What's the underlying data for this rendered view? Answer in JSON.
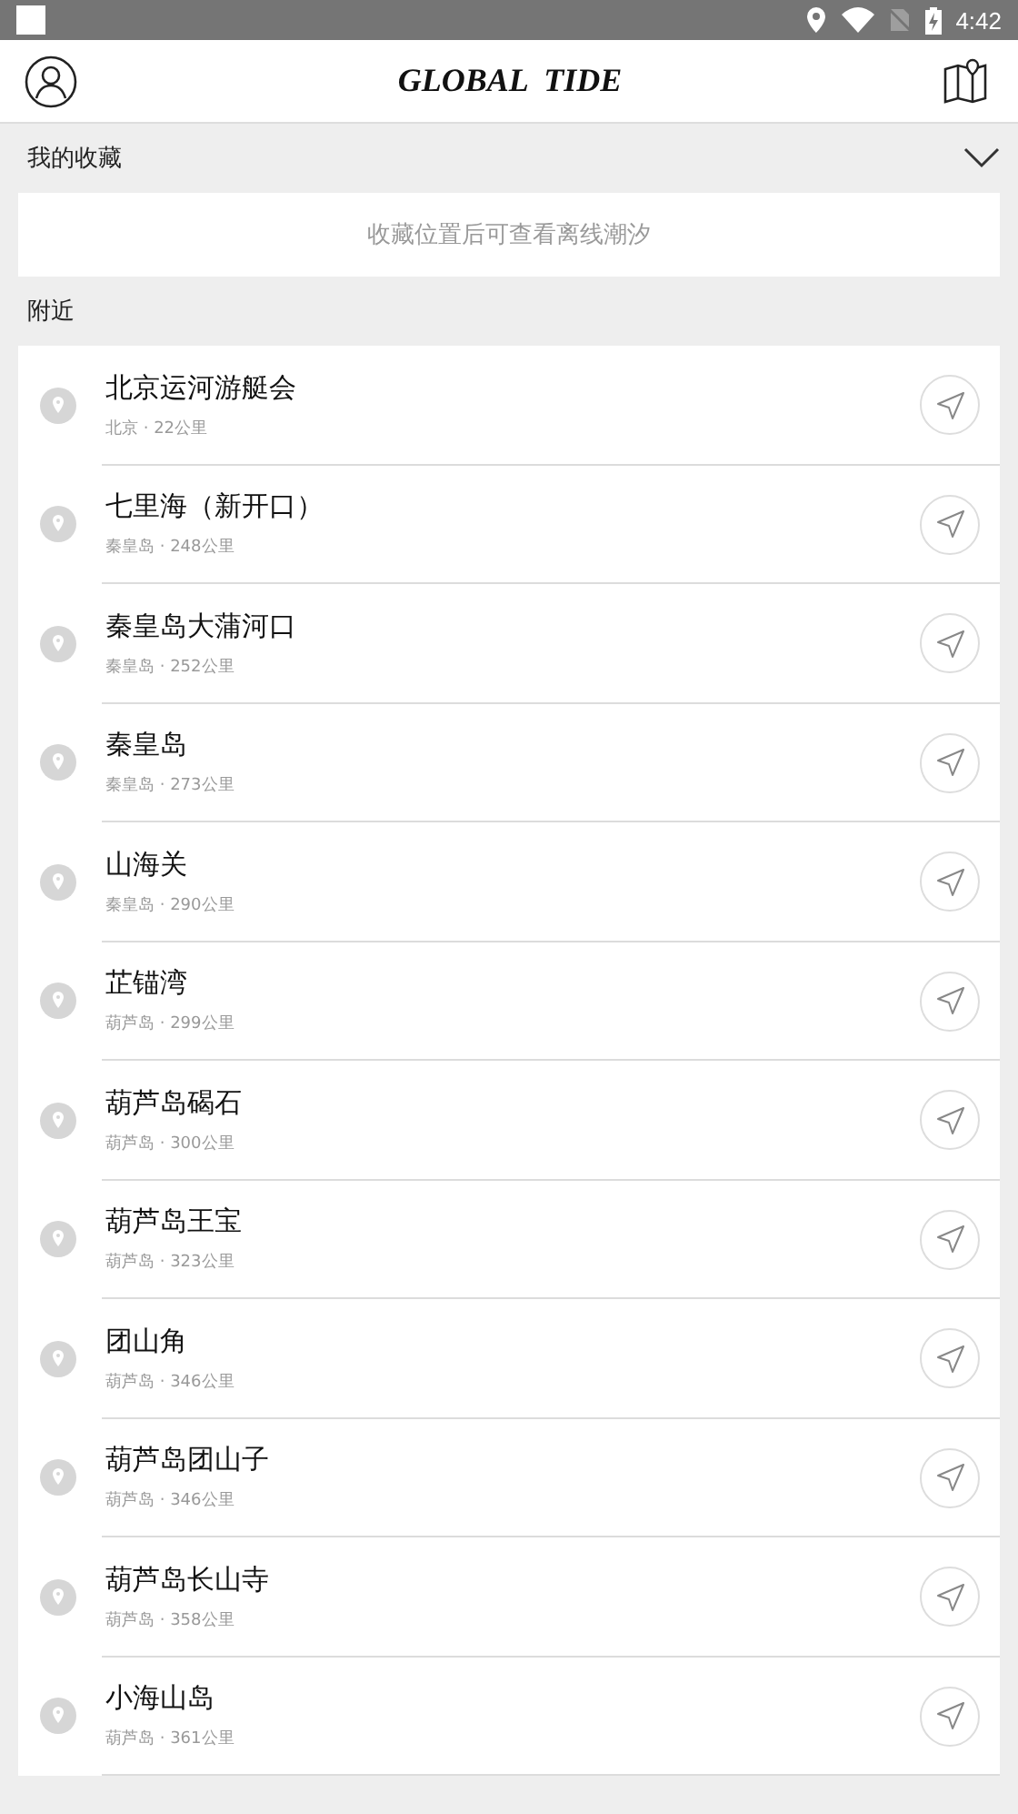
{
  "status_bar": {
    "time": "4:42"
  },
  "header": {
    "title": "GLOBAL  TIDE"
  },
  "favorites": {
    "label": "我的收藏",
    "expanded": true,
    "empty_text": "收藏位置后可查看离线潮汐"
  },
  "nearby": {
    "label": "附近",
    "items": [
      {
        "name": "北京运河游艇会",
        "detail": "北京 · 22公里"
      },
      {
        "name": "七里海（新开口）",
        "detail": "秦皇岛 · 248公里"
      },
      {
        "name": "秦皇岛大蒲河口",
        "detail": "秦皇岛 · 252公里"
      },
      {
        "name": "秦皇岛",
        "detail": "秦皇岛 · 273公里"
      },
      {
        "name": "山海关",
        "detail": "秦皇岛 · 290公里"
      },
      {
        "name": "芷锚湾",
        "detail": "葫芦岛 · 299公里"
      },
      {
        "name": "葫芦岛碣石",
        "detail": "葫芦岛 · 300公里"
      },
      {
        "name": "葫芦岛王宝",
        "detail": "葫芦岛 · 323公里"
      },
      {
        "name": "团山角",
        "detail": "葫芦岛 · 346公里"
      },
      {
        "name": "葫芦岛团山子",
        "detail": "葫芦岛 · 346公里"
      },
      {
        "name": "葫芦岛长山寺",
        "detail": "葫芦岛 · 358公里"
      },
      {
        "name": "小海山岛",
        "detail": "葫芦岛 · 361公里"
      }
    ]
  }
}
